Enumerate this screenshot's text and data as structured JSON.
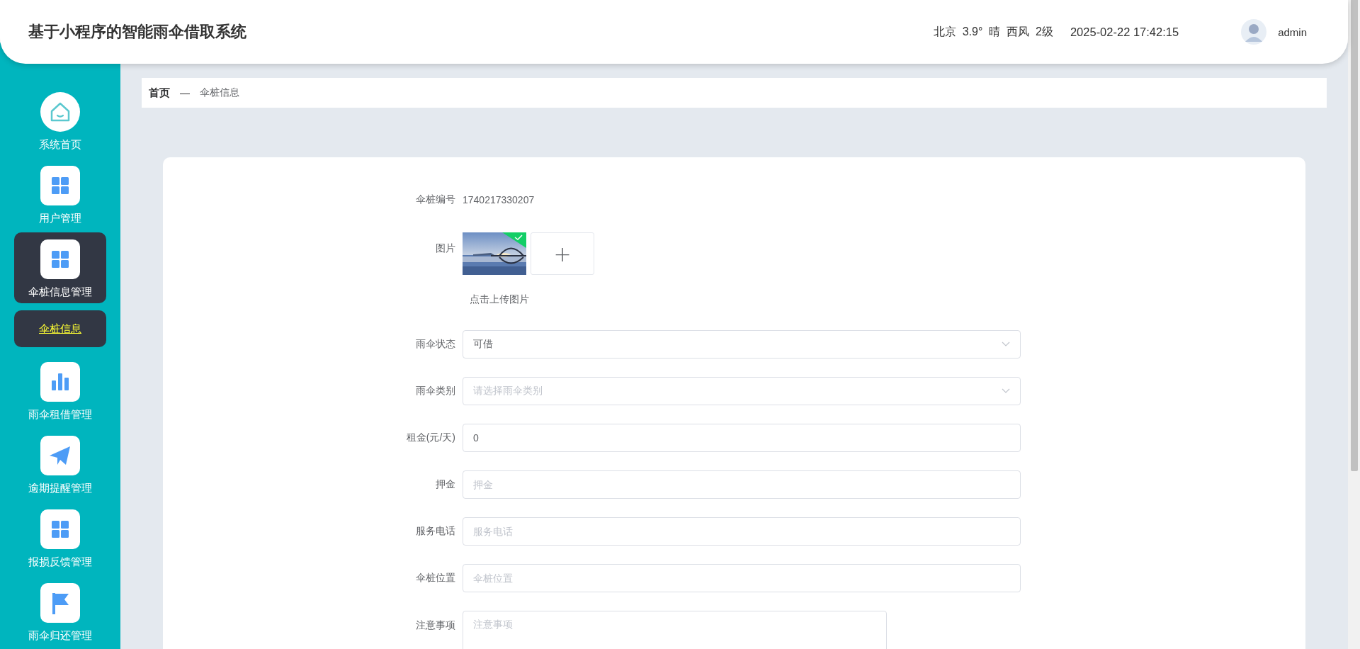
{
  "header": {
    "title": "基于小程序的智能雨伞借取系统",
    "weather": "北京  3.9°  晴  西风  2级",
    "datetime": "2025-02-22 17:42:15",
    "user": "admin"
  },
  "sidebar": {
    "items": [
      {
        "label": "系统首页",
        "kind": "home",
        "selected": false
      },
      {
        "label": "用户管理",
        "kind": "grid",
        "selected": false
      },
      {
        "label": "伞桩信息管理",
        "kind": "grid",
        "selected": true,
        "expanded": true,
        "children": [
          {
            "label": "伞桩信息",
            "selected": true
          }
        ]
      },
      {
        "label": "雨伞租借管理",
        "kind": "bars",
        "selected": false
      },
      {
        "label": "逾期提醒管理",
        "kind": "plane",
        "selected": false
      },
      {
        "label": "报损反馈管理",
        "kind": "grid",
        "selected": false
      },
      {
        "label": "雨伞归还管理",
        "kind": "flag",
        "selected": false
      }
    ]
  },
  "breadcrumb": {
    "items": [
      "首页",
      "伞桩信息"
    ],
    "separator": "—"
  },
  "form": {
    "fields": [
      {
        "label": "伞桩编号",
        "kind": "text",
        "value": "1740217330207"
      },
      {
        "label": "图片",
        "kind": "upload",
        "uploaded": true,
        "note": "点击上传图片",
        "add": "+"
      },
      {
        "label": "雨伞状态",
        "kind": "select",
        "value": "可借"
      },
      {
        "label": "雨伞类别",
        "kind": "select",
        "placeholder": "请选择雨伞类别"
      },
      {
        "label": "租金(元/天)",
        "kind": "input",
        "value": "0"
      },
      {
        "label": "押金",
        "kind": "input",
        "placeholder": "押金"
      },
      {
        "label": "服务电话",
        "kind": "input",
        "placeholder": "服务电话"
      },
      {
        "label": "伞桩位置",
        "kind": "input",
        "placeholder": "伞桩位置"
      },
      {
        "label": "注意事项",
        "kind": "textarea",
        "placeholder": "注意事项"
      }
    ]
  }
}
